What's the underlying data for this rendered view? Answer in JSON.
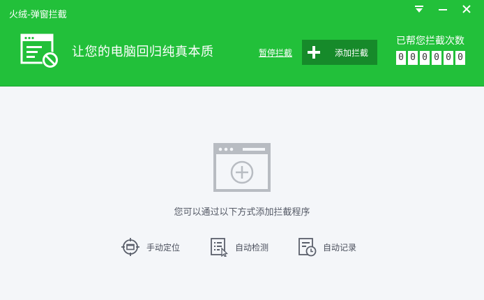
{
  "window": {
    "title": "火绒-弹窗拦截",
    "controls": [
      {
        "name": "menu",
        "icon": "dropdown-menu-icon"
      },
      {
        "name": "minimize",
        "icon": "minimize-icon"
      },
      {
        "name": "close",
        "icon": "close-icon"
      }
    ]
  },
  "header": {
    "logo_icon": "popup-block-icon",
    "slogan": "让您的电脑回归纯真本质",
    "pause_label": "暂停拦截",
    "add_button_label": "添加拦截",
    "counter_label": "已帮您拦截次数",
    "counter_digits": [
      "0",
      "0",
      "0",
      "0",
      "0",
      "0"
    ]
  },
  "main": {
    "illustration_icon": "add-window-icon",
    "hint": "您可以通过以下方式添加拦截程序",
    "methods": [
      {
        "label": "手动定位",
        "icon": "crosshair-icon"
      },
      {
        "label": "自动检测",
        "icon": "checklist-cursor-icon"
      },
      {
        "label": "自动记录",
        "icon": "document-clock-icon"
      }
    ]
  },
  "colors": {
    "header_green": "#22c03a",
    "button_dark_green": "#168a2a",
    "background": "#f4f6f9",
    "illustration_gray": "#b8bcc2"
  }
}
